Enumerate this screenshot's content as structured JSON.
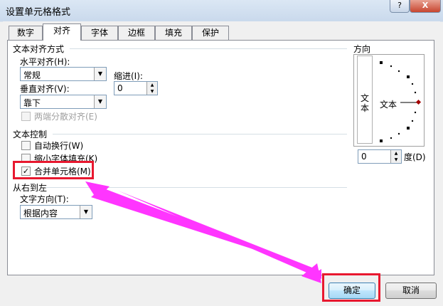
{
  "window": {
    "title": "设置单元格格式",
    "help_glyph": "?",
    "close_glyph": "X"
  },
  "tabs": [
    {
      "label": "数字"
    },
    {
      "label": "对齐"
    },
    {
      "label": "字体"
    },
    {
      "label": "边框"
    },
    {
      "label": "填充"
    },
    {
      "label": "保护"
    }
  ],
  "active_tab": "对齐",
  "alignment": {
    "group_label": "文本对齐方式",
    "horizontal_label": "水平对齐(H):",
    "horizontal_value": "常规",
    "indent_label": "缩进(I):",
    "indent_value": "0",
    "vertical_label": "垂直对齐(V):",
    "vertical_value": "靠下",
    "distributed_label": "两端分散对齐(E)"
  },
  "text_control": {
    "group_label": "文本控制",
    "wrap_label": "自动换行(W)",
    "wrap_checked": false,
    "shrink_label": "缩小字体填充(K)",
    "shrink_checked": false,
    "merge_label": "合并单元格(M)",
    "merge_checked": true,
    "check_glyph": "✓"
  },
  "rtl": {
    "group_label": "从右到左",
    "direction_label": "文字方向(T):",
    "direction_value": "根据内容"
  },
  "orientation": {
    "group_label": "方向",
    "vertical_text": "文本",
    "horizontal_text": "文本",
    "degrees_value": "0",
    "degrees_label": "度(D)"
  },
  "buttons": {
    "ok": "确定",
    "cancel": "取消"
  },
  "colors": {
    "highlight": "#e8182f",
    "arrow": "#ff35ff"
  }
}
